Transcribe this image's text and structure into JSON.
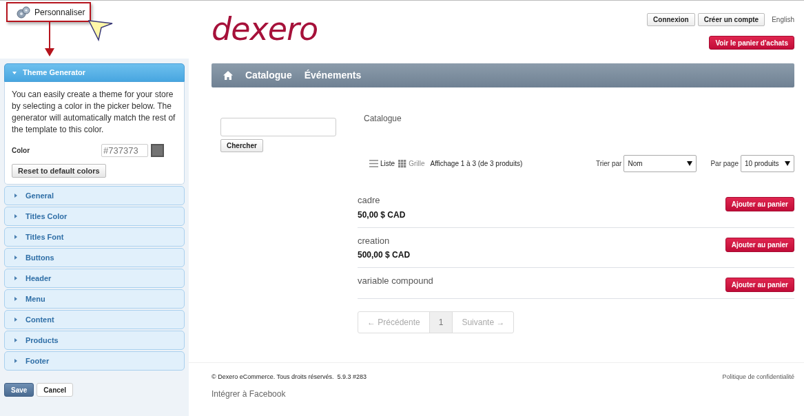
{
  "customize_button": {
    "label": "Personnaliser"
  },
  "theme_panel": {
    "sections": [
      {
        "title": "Theme Generator",
        "expanded": true
      },
      {
        "title": "General",
        "expanded": false
      },
      {
        "title": "Titles Color",
        "expanded": false
      },
      {
        "title": "Titles Font",
        "expanded": false
      },
      {
        "title": "Buttons",
        "expanded": false
      },
      {
        "title": "Header",
        "expanded": false
      },
      {
        "title": "Menu",
        "expanded": false
      },
      {
        "title": "Content",
        "expanded": false
      },
      {
        "title": "Products",
        "expanded": false
      },
      {
        "title": "Footer",
        "expanded": false
      }
    ],
    "description": "You can easily create a theme for your store by selecting a color in the picker below. The generator will automatically match the rest of the template to this color.",
    "color_label": "Color",
    "color_value": "#737373",
    "color": "#737373",
    "reset_button": "Reset to default colors",
    "save_button": "Save",
    "cancel_button": "Cancel"
  },
  "header": {
    "logo": "dexero",
    "login_button": "Connexion",
    "register_button": "Créer un compte",
    "language_link": "English",
    "cart_button": "Voir le panier d'achats"
  },
  "nav": {
    "items": [
      "Catalogue",
      "Événements"
    ]
  },
  "search": {
    "button": "Chercher"
  },
  "catalog": {
    "title": "Catalogue",
    "views": [
      {
        "label": "Liste",
        "selected": true
      },
      {
        "label": "Grille",
        "selected": false
      }
    ],
    "count": "Affichage 1 à 3 (de 3 produits)",
    "sort_label": "Trier par",
    "sort_value": "Nom",
    "per_page_label": "Par page",
    "per_page_value": "10 produits",
    "products": [
      {
        "name": "cadre",
        "price": "50,00 $ CAD",
        "button": "Ajouter au panier"
      },
      {
        "name": "creation",
        "price": "500,00 $ CAD",
        "button": "Ajouter au panier"
      },
      {
        "name": "variable compound",
        "button": "Ajouter au panier"
      }
    ],
    "pagination": {
      "previous": {
        "label": "← Précédente",
        "disabled": true
      },
      "pages": [
        {
          "label": "1",
          "selected": true
        }
      ],
      "next": {
        "label": "Suivante →",
        "disabled": true
      }
    }
  },
  "footer": {
    "copyright": "© Dexero eCommerce. Tous droits réservés.  5.9.3 #283",
    "privacy_link": "Politique de confidentialité",
    "facebook_link": "Intégrer à Facebook"
  }
}
